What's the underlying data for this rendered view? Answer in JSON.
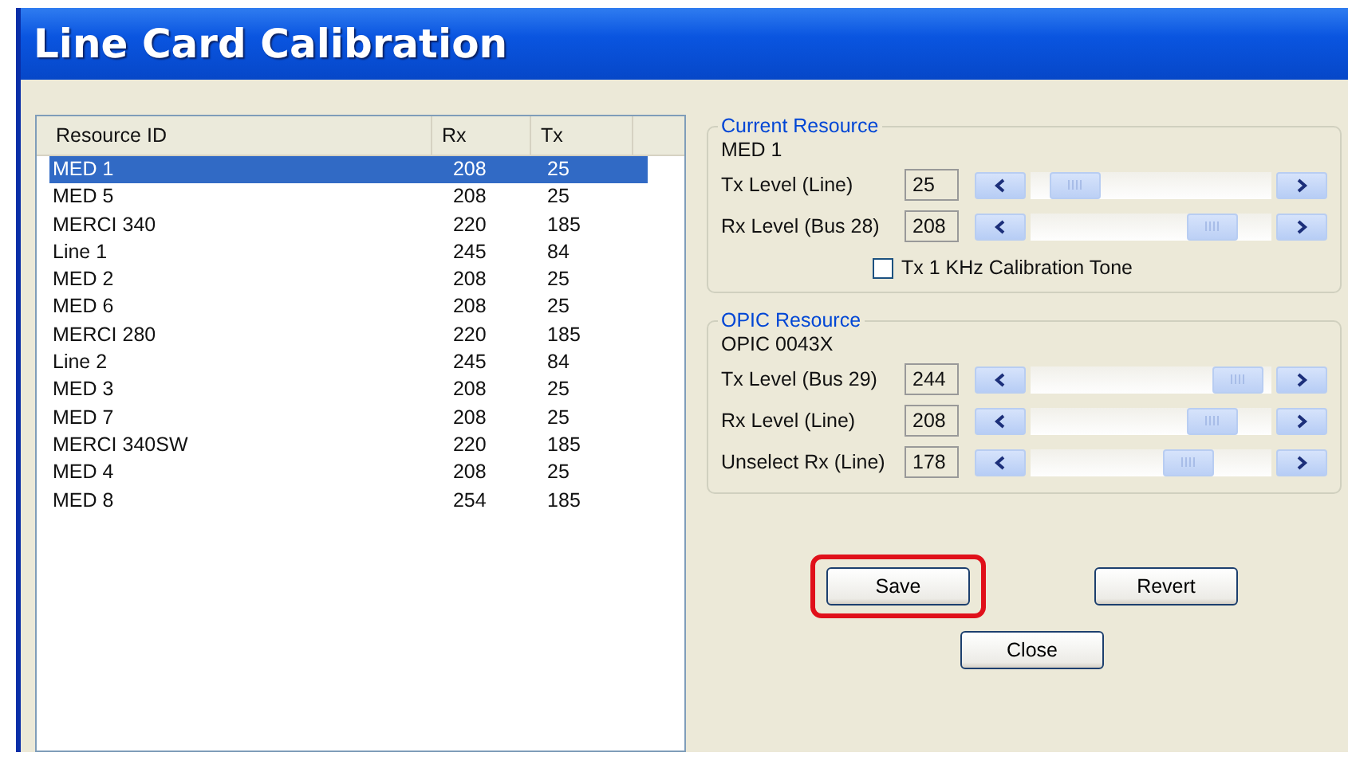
{
  "window": {
    "title": "Line Card Calibration"
  },
  "table": {
    "columns": [
      "Resource ID",
      "Rx",
      "Tx"
    ],
    "rows": [
      {
        "cells": [
          "MED 1",
          "208",
          "25"
        ],
        "selected": true
      },
      {
        "cells": [
          "MED 5",
          "208",
          "25"
        ],
        "selected": false
      },
      {
        "cells": [
          "MERCI 340",
          "220",
          "185"
        ],
        "selected": false
      },
      {
        "cells": [
          "Line 1",
          "245",
          "84"
        ],
        "selected": false
      },
      {
        "cells": [
          "MED 2",
          "208",
          "25"
        ],
        "selected": false
      },
      {
        "cells": [
          "MED 6",
          "208",
          "25"
        ],
        "selected": false
      },
      {
        "cells": [
          "MERCI 280",
          "220",
          "185"
        ],
        "selected": false
      },
      {
        "cells": [
          "Line 2",
          "245",
          "84"
        ],
        "selected": false
      },
      {
        "cells": [
          "MED 3",
          "208",
          "25"
        ],
        "selected": false
      },
      {
        "cells": [
          "MED 7",
          "208",
          "25"
        ],
        "selected": false
      },
      {
        "cells": [
          "MERCI 340SW",
          "220",
          "185"
        ],
        "selected": false
      },
      {
        "cells": [
          "MED 4",
          "208",
          "25"
        ],
        "selected": false
      },
      {
        "cells": [
          "MED 8",
          "254",
          "185"
        ],
        "selected": false
      }
    ]
  },
  "current_resource": {
    "title": "Current Resource",
    "name": "MED 1",
    "sliders": [
      {
        "label": "Tx Level (Line)",
        "reading": "25",
        "level": 0.1
      },
      {
        "label": "Rx Level (Bus 28)",
        "reading": "208",
        "level": 0.82
      }
    ],
    "checkbox": {
      "label": "Tx 1 KHz Calibration Tone",
      "checked": false
    }
  },
  "opic_resource": {
    "title": "OPIC Resource",
    "name": "OPIC 0043X",
    "sliders": [
      {
        "label": "Tx Level (Bus 29)",
        "reading": "244",
        "level": 0.96
      },
      {
        "label": "Rx Level (Line)",
        "reading": "208",
        "level": 0.82
      },
      {
        "label": "Unselect Rx (Line)",
        "reading": "178",
        "level": 0.7
      }
    ]
  },
  "buttons": [
    {
      "label": "Save",
      "highlighted": true
    },
    {
      "label": "Revert",
      "highlighted": false
    },
    {
      "label": "Close",
      "highlighted": false
    }
  ]
}
